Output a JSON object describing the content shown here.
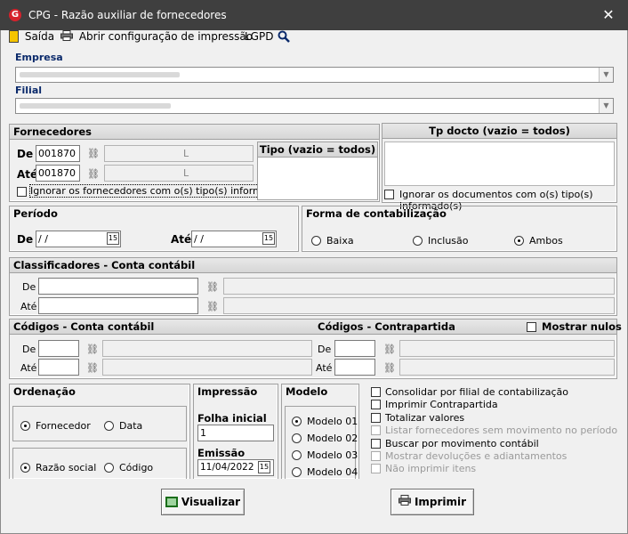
{
  "window": {
    "title": "CPG - Razão auxiliar de fornecedores",
    "logo": "G",
    "close": "✕"
  },
  "toolbar": {
    "exit": "Saída",
    "print_config": "Abrir configuração de impressão",
    "lgpd": "LGPD"
  },
  "empresa": {
    "label": "Empresa",
    "value": ""
  },
  "filial": {
    "label": "Filial",
    "value": ""
  },
  "fornecedores": {
    "title": "Fornecedores",
    "de_label": "De",
    "de_code": "001870",
    "ate_label": "Até",
    "ate_code": "001870",
    "name_suffix_1": "L",
    "name_suffix_2": "L",
    "ignore_label": "Ignorar os fornecedores com o(s) tipo(s) informado(s)",
    "tipo_title": "Tipo (vazio = todos)"
  },
  "tpdocto": {
    "title": "Tp docto (vazio = todos)",
    "ignore_label": "Ignorar os documentos com o(s) tipo(s) informado(s)"
  },
  "periodo": {
    "title": "Período",
    "de_label": "De",
    "de_value": " / /",
    "ate_label": "Até",
    "ate_value": " / /",
    "cal_icon": "15"
  },
  "forma": {
    "title": "Forma de contabilização",
    "options": [
      "Baixa",
      "Inclusão",
      "Ambos"
    ],
    "selected": "Ambos"
  },
  "classificadores": {
    "title": "Classificadores - Conta contábil",
    "de_label": "De",
    "ate_label": "Até"
  },
  "codigos": {
    "title": "Códigos - Conta contábil",
    "de_label": "De",
    "ate_label": "Até"
  },
  "contrapartida": {
    "title": "Códigos - Contrapartida",
    "de_label": "De",
    "ate_label": "Até",
    "nulos_label": "Mostrar nulos"
  },
  "ordenacao": {
    "title": "Ordenação",
    "opt1a": "Fornecedor",
    "opt1b": "Data",
    "opt2a": "Razão social",
    "opt2b": "Código"
  },
  "impressao": {
    "title": "Impressão",
    "folha_label": "Folha inicial",
    "folha_value": "1",
    "emissao_label": "Emissão",
    "emissao_value": "11/04/2022",
    "cal_icon": "15"
  },
  "modelo": {
    "title": "Modelo",
    "options": [
      "Modelo 01",
      "Modelo 02",
      "Modelo 03",
      "Modelo 04"
    ],
    "selected": "Modelo 01"
  },
  "checks": [
    {
      "label": "Consolidar por filial de contabilização",
      "enabled": true
    },
    {
      "label": "Imprimir Contrapartida",
      "enabled": true
    },
    {
      "label": "Totalizar valores",
      "enabled": true
    },
    {
      "label": "Listar fornecedores sem movimento no período",
      "enabled": false
    },
    {
      "label": "Buscar por movimento contábil",
      "enabled": true
    },
    {
      "label": "Mostrar devoluções e adiantamentos",
      "enabled": false
    },
    {
      "label": "Não imprimir itens",
      "enabled": false
    }
  ],
  "buttons": {
    "visualizar": "Visualizar",
    "imprimir": "Imprimir"
  }
}
